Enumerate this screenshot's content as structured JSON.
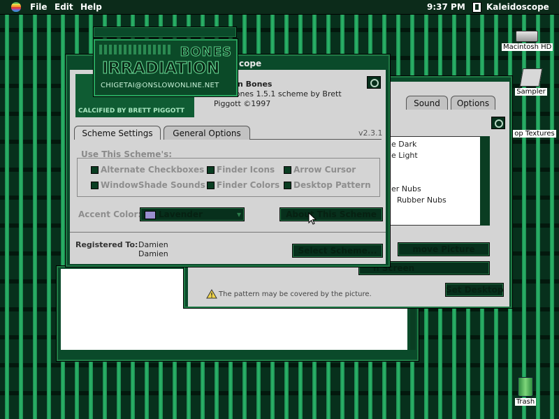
{
  "menubar": {
    "menus": [
      "File",
      "Edit",
      "Help"
    ],
    "clock": "9:37 PM",
    "app_name": "Kaleidoscope"
  },
  "desktop_icons": {
    "hd": "Macintosh HD",
    "sampler": "Sampler",
    "textures": "op Textures",
    "trash": "Trash"
  },
  "splash": {
    "bones": "BONES",
    "irradiation": "IRRADIATION",
    "email": "CHIGETAI@ONSLOWONLINE.NET"
  },
  "main_window": {
    "title_partial": "cope",
    "scheme_name_partial": "ation Bones",
    "description_line1": "on Bones 1.5.1 scheme by Brett",
    "description_line2": "Piggott ©1997",
    "calcified_by": "CALCIFIED BY BRETT PIGGOTT",
    "version": "v2.3.1",
    "tabs": [
      "Scheme Settings",
      "General Options"
    ],
    "group_label": "Use This Scheme's:",
    "checkboxes": [
      "Alternate Checkboxes",
      "Finder Icons",
      "Arrow Cursor",
      "WindowShade Sounds",
      "Finder Colors",
      "Desktop Pattern"
    ],
    "accent_label": "Accent Color:",
    "accent_value": "Lavender",
    "accent_swatch": "#9a8fcf",
    "about_button": "About This Scheme",
    "registered_label": "Registered To:",
    "registered_name1": "Damien",
    "registered_name2": "Damien",
    "select_button": "Select Scheme..."
  },
  "back_window": {
    "tabs": [
      "Sound",
      "Options"
    ],
    "list_items": [
      "e Dark",
      "e Light",
      "er Nubs",
      "Rubber Nubs"
    ],
    "remove_button": "move Picture",
    "position_value": "n Screen",
    "set_desktop_button": "Set Desktop",
    "warning": "The pattern may be covered by the picture."
  }
}
